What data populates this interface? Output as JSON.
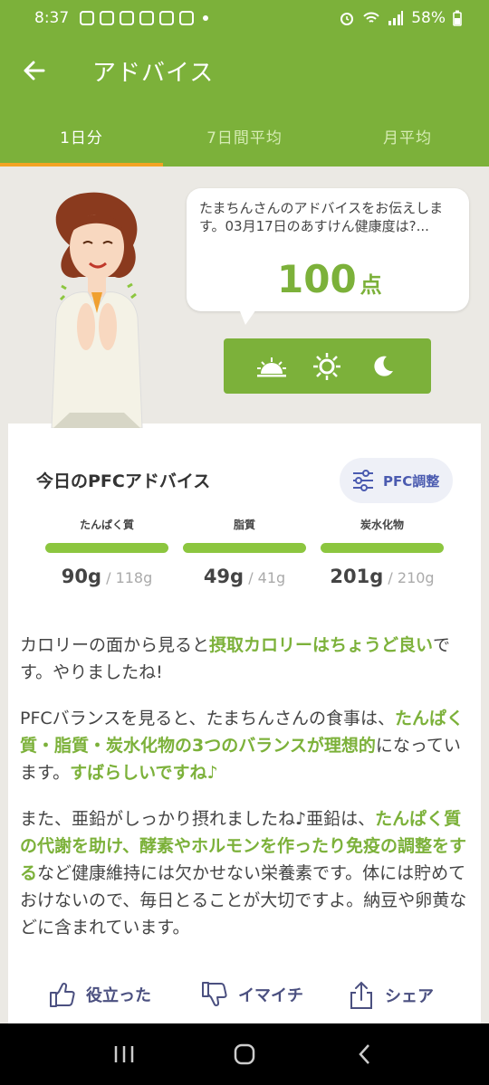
{
  "status_bar": {
    "time": "8:37",
    "battery": "58%"
  },
  "app_bar": {
    "title": "アドバイス"
  },
  "tabs": [
    {
      "label": "1日分",
      "active": true
    },
    {
      "label": "7日間平均",
      "active": false
    },
    {
      "label": "月平均",
      "active": false
    }
  ],
  "bubble": {
    "text": "たまちんさんのアドバイスをお伝えします。03月17日のあすけん健康度は?...",
    "score": "100",
    "score_unit": "点"
  },
  "time_toggle": [
    "sunrise-icon",
    "sun-icon",
    "moon-icon"
  ],
  "pfc": {
    "title": "今日のPFCアドバイス",
    "adjust_label": "PFC調整",
    "items": [
      {
        "label": "たんぱく質",
        "value": "90",
        "unit": "g",
        "target": "/ 118g",
        "ratio": 1.0
      },
      {
        "label": "脂質",
        "value": "49",
        "unit": "g",
        "target": "/ 41g",
        "ratio": 1.0
      },
      {
        "label": "炭水化物",
        "value": "201",
        "unit": "g",
        "target": "/ 210g",
        "ratio": 1.0
      }
    ]
  },
  "advice": {
    "p1_a": "カロリーの面から見ると",
    "p1_b": "摂取カロリーはちょうど良い",
    "p1_c": "です。やりましたね!",
    "p2_a": "PFCバランスを見ると、たまちんさんの食事は、",
    "p2_b": "たんぱく質・脂質・炭水化物の3つのバランスが理想的",
    "p2_c": "になっています。",
    "p2_d": "すばらしいですね♪",
    "p3_a": "また、亜鉛がしっかり摂れましたね♪亜鉛は、",
    "p3_b": "たんぱく質の代謝を助け、酵素やホルモンを作ったり免疫の調整をする",
    "p3_c": "など健康維持には欠かせない栄養素です。体には貯めておけないので、毎日とることが大切ですよ。納豆や卵黄などに含まれています。"
  },
  "actions": {
    "helpful": "役立った",
    "not_good": "イマイチ",
    "share": "シェア"
  },
  "colors": {
    "primary": "#7cb13a",
    "tab_indicator": "#f3a324",
    "bar": "#8cc63f",
    "accent_text": "#4b5bb0"
  }
}
